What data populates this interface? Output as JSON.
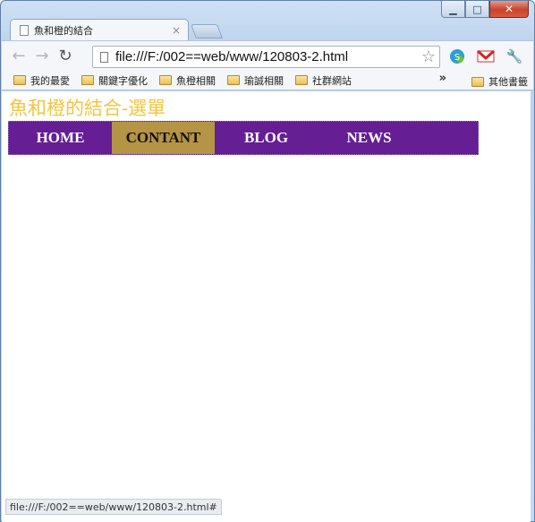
{
  "window": {
    "controls": {
      "minimize": "▁",
      "maximize": "□",
      "close": "✕"
    }
  },
  "tab": {
    "title": "魚和橙的結合",
    "close": "×"
  },
  "toolbar": {
    "back": "←",
    "forward": "→",
    "reload": "↻",
    "url": "file:///F:/002==web/www/120803-2.html",
    "star": "☆",
    "wrench": "🔧"
  },
  "bookmarks": {
    "items": [
      {
        "label": "我的最愛"
      },
      {
        "label": "關鍵字優化"
      },
      {
        "label": "魚橙相關"
      },
      {
        "label": "瑜誠相關"
      },
      {
        "label": "社群網站"
      }
    ],
    "overflow": "»",
    "other": "其他書籤"
  },
  "page": {
    "title": "魚和橙的結合-選單",
    "menu": [
      {
        "label": "HOME"
      },
      {
        "label": "CONTANT"
      },
      {
        "label": "BLOG"
      },
      {
        "label": "NEWS"
      }
    ]
  },
  "status": {
    "text": "file:///F:/002==web/www/120803-2.html#"
  },
  "colors": {
    "menu_bg": "#651e94",
    "menu_active_bg": "#b59445",
    "title_color": "#f2c542"
  }
}
